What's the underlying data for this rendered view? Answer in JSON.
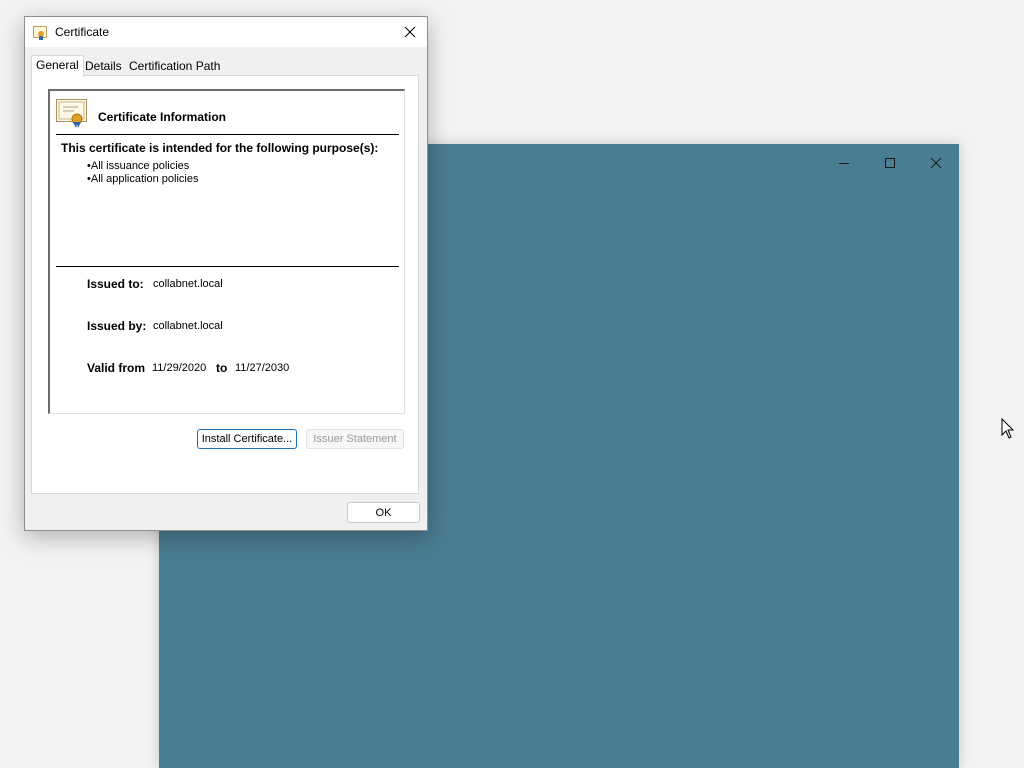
{
  "dialog": {
    "title": "Certificate",
    "close_label": "×",
    "tabs": [
      {
        "label": "General",
        "active": true
      },
      {
        "label": "Details",
        "active": false
      },
      {
        "label": "Certification Path",
        "active": false
      }
    ],
    "info": {
      "heading": "Certificate Information",
      "purpose_heading": "This certificate is intended for the following purpose(s):",
      "purposes": [
        "All issuance policies",
        "All application policies"
      ],
      "issued_to_label": "Issued to:",
      "issued_to_value": "collabnet.local",
      "issued_by_label": "Issued by:",
      "issued_by_value": "collabnet.local",
      "valid_from_label": "Valid from",
      "valid_from_value": "11/29/2020",
      "valid_to_label": "to",
      "valid_to_value": "11/27/2030"
    },
    "buttons": {
      "install": "Install Certificate...",
      "issuer_statement": "Issuer Statement",
      "ok": "OK"
    }
  },
  "background_window": {
    "color": "#4a7d91",
    "controls": [
      "minimize-icon",
      "maximize-icon",
      "close-icon"
    ]
  }
}
